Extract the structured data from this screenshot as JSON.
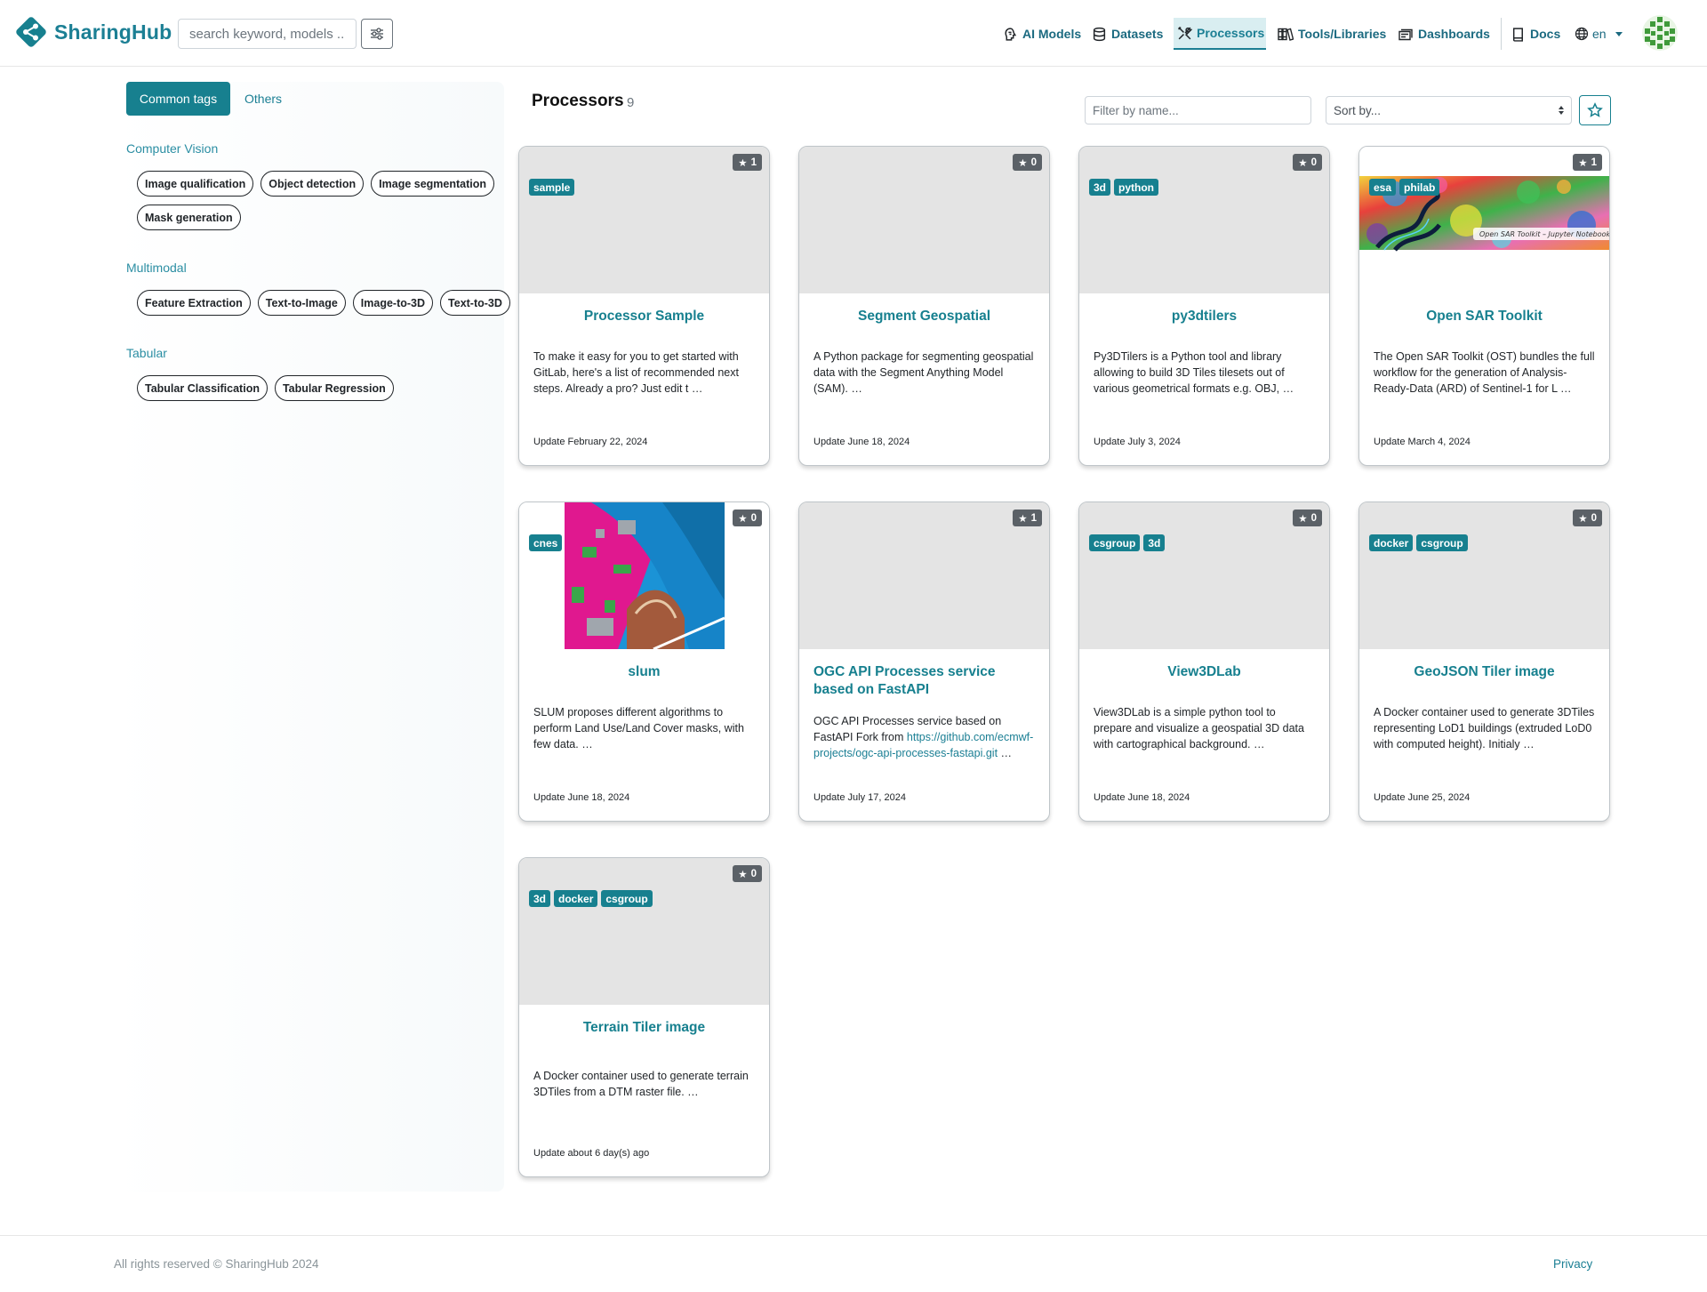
{
  "brand": {
    "name": "SharingHub"
  },
  "search": {
    "placeholder": "search keyword, models ..."
  },
  "nav": {
    "ai_models": "AI Models",
    "datasets": "Datasets",
    "processors": "Processors",
    "tools": "Tools/Libraries",
    "dashboards": "Dashboards",
    "docs": "Docs",
    "lang": "en"
  },
  "colors": {
    "accent": "#17808f",
    "link": "#1b7f94",
    "badge": "#5b6167"
  },
  "sidebar": {
    "tabs": {
      "common": "Common tags",
      "others": "Others"
    },
    "sections": [
      {
        "title": "Computer Vision",
        "tags": [
          "Image qualification",
          "Object detection",
          "Image segmentation",
          "Mask generation"
        ]
      },
      {
        "title": "Multimodal",
        "tags": [
          "Feature Extraction",
          "Text-to-Image",
          "Image-to-3D",
          "Text-to-3D"
        ]
      },
      {
        "title": "Tabular",
        "tags": [
          "Tabular Classification",
          "Tabular Regression"
        ]
      }
    ]
  },
  "main": {
    "title": "Processors",
    "count": "9",
    "filter_placeholder": "Filter by name...",
    "sort_label": "Sort by..."
  },
  "cards": [
    {
      "title": "Processor Sample",
      "stars": "1",
      "tags": [
        "sample"
      ],
      "desc": "To make it easy for you to get started with GitLab, here's a list of recommended next steps. Already a pro? Just edit t …",
      "date": "Update February 22, 2024"
    },
    {
      "title": "Segment Geospatial",
      "stars": "0",
      "tags": [],
      "desc": "A Python package for segmenting geospatial data with the Segment Anything Model (SAM). …",
      "date": "Update June 18, 2024"
    },
    {
      "title": "py3dtilers",
      "stars": "0",
      "tags": [
        "3d",
        "python"
      ],
      "desc": "Py3DTilers is a Python tool and library allowing to build 3D Tiles tilesets out of various geometrical formats e.g. OBJ, …",
      "date": "Update July 3, 2024"
    },
    {
      "title": "Open SAR Toolkit",
      "stars": "1",
      "tags": [
        "esa",
        "philab"
      ],
      "thumb_caption": "Open SAR Toolkit – Jupyter Notebook Tut",
      "desc": "The Open SAR Toolkit (OST) bundles the full workflow for the generation of Analysis-Ready-Data (ARD) of Sentinel-1 for L …",
      "date": "Update March 4, 2024"
    },
    {
      "title": "slum",
      "stars": "0",
      "tags": [
        "cnes"
      ],
      "desc": "SLUM proposes different algorithms to perform Land Use/Land Cover masks, with few data. …",
      "date": "Update June 18, 2024"
    },
    {
      "title": "OGC API Processes service based on FastAPI",
      "stars": "1",
      "tags": [],
      "desc_text": "OGC API Processes service based on FastAPI Fork from ",
      "desc_link": "https://github.com/ecmwf-projects/ogc-api-processes-fastapi.git",
      "desc_tail": " …",
      "date": "Update July 17, 2024"
    },
    {
      "title": "View3DLab",
      "stars": "0",
      "tags": [
        "csgroup",
        "3d"
      ],
      "desc": "View3DLab is a simple python tool to prepare and visualize a geospatial 3D data with cartographical background. …",
      "date": "Update June 18, 2024"
    },
    {
      "title": "GeoJSON Tiler image",
      "stars": "0",
      "tags": [
        "docker",
        "csgroup"
      ],
      "desc": "A Docker container used to generate 3DTiles representing LoD1 buildings (extruded LoD0 with computed height). Initialy …",
      "date": "Update June 25, 2024"
    },
    {
      "title": "Terrain Tiler image",
      "stars": "0",
      "tags": [
        "3d",
        "docker",
        "csgroup"
      ],
      "desc": "A Docker container used to generate terrain 3DTiles from a DTM raster file. …",
      "date": "Update about 6 day(s) ago"
    }
  ],
  "footer": {
    "copyright": "All rights reserved © SharingHub 2024",
    "privacy": "Privacy"
  }
}
